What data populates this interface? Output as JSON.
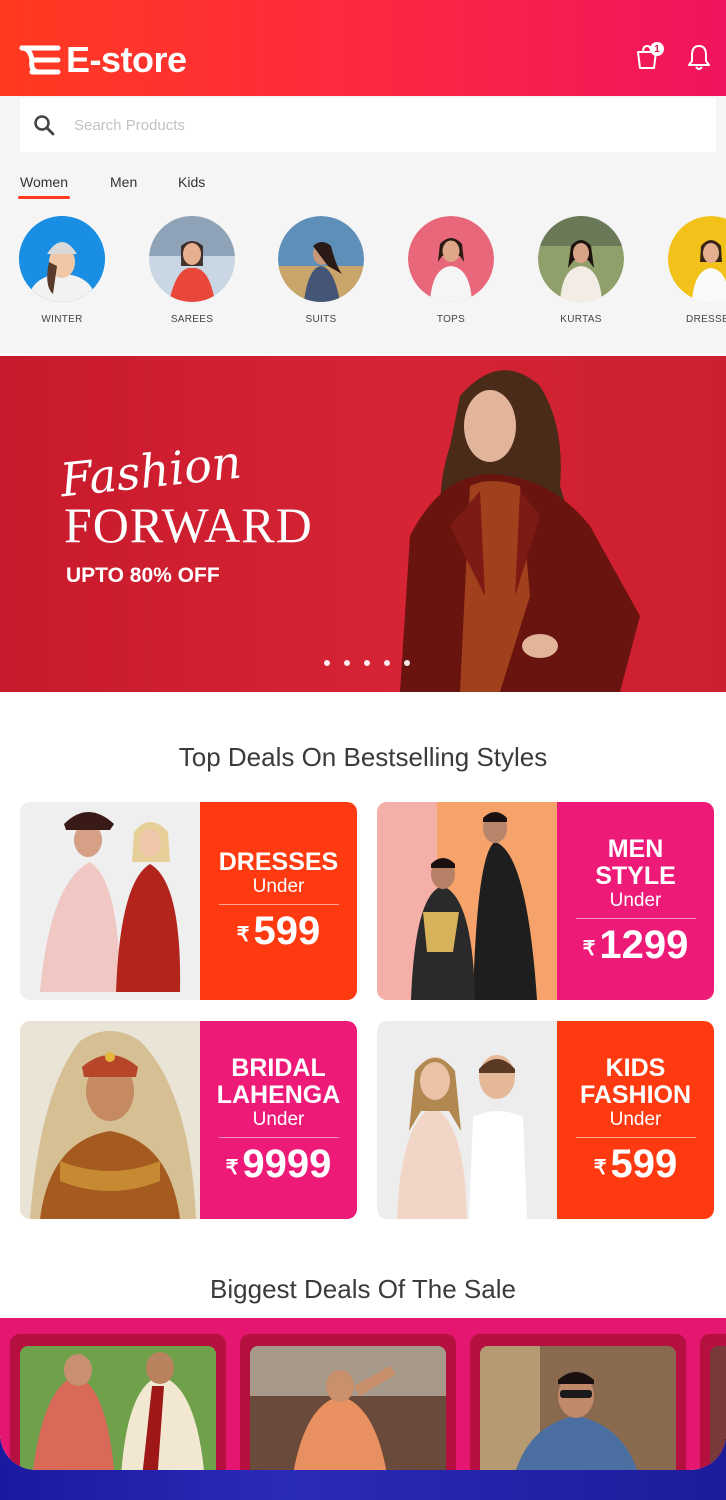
{
  "app": {
    "logo_text": "E-store",
    "cart_count": "1"
  },
  "search": {
    "placeholder": "Search Products"
  },
  "category_tabs": [
    {
      "label": "Women",
      "active": true
    },
    {
      "label": "Men",
      "active": false
    },
    {
      "label": "Kids",
      "active": false
    }
  ],
  "categories": [
    {
      "label": "WINTER"
    },
    {
      "label": "SAREES"
    },
    {
      "label": "SUITS"
    },
    {
      "label": "TOPS"
    },
    {
      "label": "KURTAS"
    },
    {
      "label": "DRESSES"
    }
  ],
  "hero": {
    "script_text": "Fashion",
    "title": "FORWARD",
    "subtitle": "UPTO 80% OFF",
    "slide_count": 5,
    "active_slide": 1
  },
  "top_deals": {
    "title": "Top Deals On Bestselling Styles",
    "cards": [
      {
        "category": "DRESSES",
        "under": "Under",
        "currency": "₹",
        "price": "599",
        "color": "#ff3a10"
      },
      {
        "category": "MEN STYLE",
        "under": "Under",
        "currency": "₹",
        "price": "1299",
        "color": "#ee1a78"
      },
      {
        "category": "BRIDAL LAHENGA",
        "under": "Under",
        "currency": "₹",
        "price": "9999",
        "color": "#ee1a78"
      },
      {
        "category": "KIDS FASHION",
        "under": "Under",
        "currency": "₹",
        "price": "599",
        "color": "#ff3a10"
      }
    ]
  },
  "biggest_deals": {
    "title": "Biggest Deals Of The Sale"
  },
  "colors": {
    "header_start": "#ff3a1f",
    "header_end": "#f0145e",
    "hero_bg": "#d62434",
    "big_deals_bg": "#e41670"
  }
}
